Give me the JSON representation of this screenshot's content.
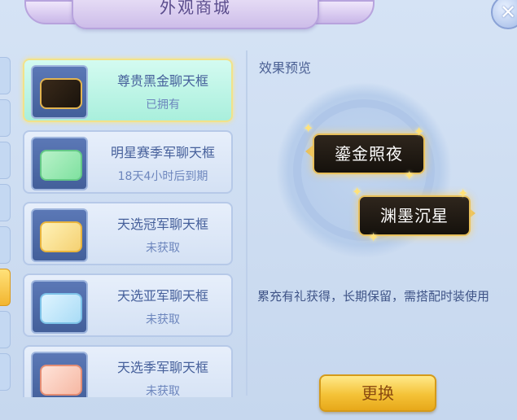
{
  "window": {
    "title": "外观商城",
    "close_icon": "close-icon"
  },
  "list": {
    "items": [
      {
        "name": "尊贵黑金聊天框",
        "status": "已拥有",
        "selected": true,
        "bubble": "black"
      },
      {
        "name": "明星赛季军聊天框",
        "status": "18天4小时后到期",
        "selected": false,
        "bubble": "green"
      },
      {
        "name": "天选冠军聊天框",
        "status": "未获取",
        "selected": false,
        "bubble": "gold"
      },
      {
        "name": "天选亚军聊天框",
        "status": "未获取",
        "selected": false,
        "bubble": "blue"
      },
      {
        "name": "天选季军聊天框",
        "status": "未获取",
        "selected": false,
        "bubble": "pink"
      }
    ]
  },
  "preview": {
    "label": "效果预览",
    "sample_1": "鎏金照夜",
    "sample_2": "渊墨沉星",
    "description": "累充有礼获得，长期保留，需搭配时装使用"
  },
  "actions": {
    "swap_label": "更换"
  },
  "colors": {
    "accent_gold": "#f4c237",
    "selected_bg": "#a9efdc",
    "text_blue": "#46609b"
  }
}
